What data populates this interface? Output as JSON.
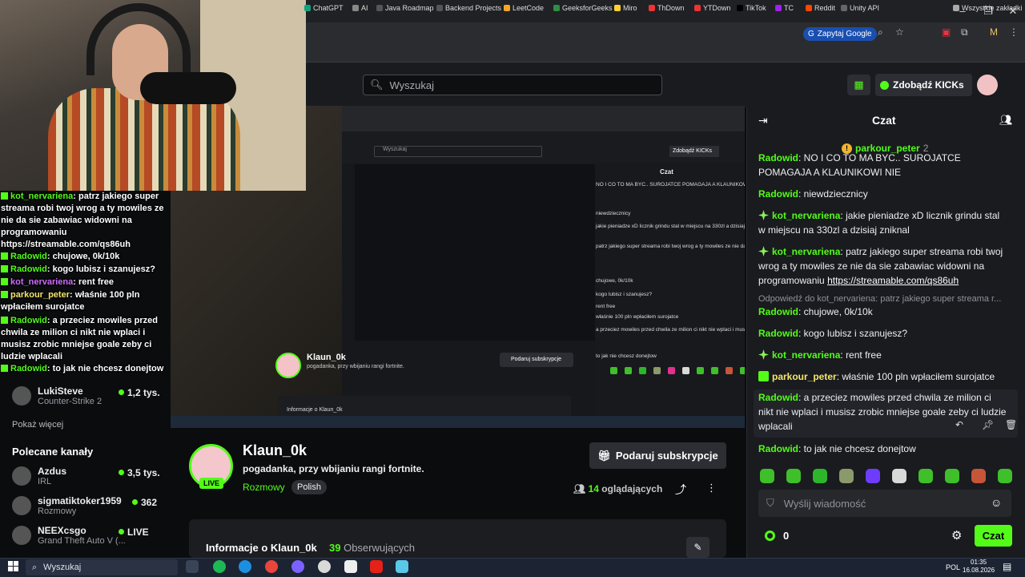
{
  "browser": {
    "google_chip": "Zapytaj Google",
    "bookmarks": [
      "ChatGPT",
      "AI",
      "Java Roadmap",
      "Backend Projects",
      "LeetCode",
      "GeeksforGeeks",
      "Miro",
      "ThDown",
      "YTDown",
      "TikTok",
      "TC",
      "Reddit",
      "Unity API"
    ],
    "all_bookmarks": "Wszystkie zakładki"
  },
  "header": {
    "search_placeholder": "Wyszukaj",
    "kicks_button": "Zdobądź KICKs"
  },
  "overlay_chat": [
    {
      "user": "kot_nervariena",
      "text": "patrz jakiego super streama robi twoj wrog a ty mowiles ze nie da sie zabawiac widowni na programowaniu https://streamable.com/qs86uh"
    },
    {
      "user": "Radowid",
      "text": "chujowe, 0k/10k"
    },
    {
      "user": "Radowid",
      "text": "kogo lubisz i szanujesz?"
    },
    {
      "user": "kot_nervariena",
      "text": "rent free"
    },
    {
      "user": "parkour_peter",
      "text": "właśnie 100 pln wpłaciłem surojatce"
    },
    {
      "user": "Radowid",
      "text": "a przeciez mowiles przed chwila ze milion ci nikt nie wplaci i musisz zrobic mniejse goale zeby ci ludzie wplacali"
    },
    {
      "user": "Radowid",
      "text": "to jak nie chcesz donejtow"
    }
  ],
  "sidebar": {
    "show_more": "Pokaż więcej",
    "recommended_title": "Polecane kanały",
    "followed": [
      {
        "name": "LukiSteve",
        "category": "Counter-Strike 2",
        "viewers": "1,2 tys."
      }
    ],
    "recommended": [
      {
        "name": "Azdus",
        "category": "IRL",
        "viewers": "3,5 tys."
      },
      {
        "name": "sigmatiktoker1959",
        "category": "Rozmowy",
        "viewers": "362"
      },
      {
        "name": "NEEXcsgo",
        "category": "Grand Theft Auto V (...",
        "viewers": "LIVE"
      }
    ]
  },
  "channel": {
    "name": "Klaun_0k",
    "live_badge": "LIVE",
    "description": "pogadanka, przy wbijaniu rangi fortnite.",
    "category": "Rozmowy",
    "tag": "Polish",
    "subscribe": "Podaruj subskrypcje",
    "viewers_count": "14",
    "viewers_label": "oglądających",
    "about_title": "Informacje o Klaun_0k",
    "followers_count": "39",
    "followers_label": "Obserwujących"
  },
  "chat": {
    "title": "Czat",
    "pinned_user": "parkour_peter",
    "pinned_count": "2",
    "messages": [
      {
        "user": "Radowid",
        "text": "NO I CO TO MA BYC.. SUROJATCE POMAGAJA A KLAUNIKOWI NIE"
      },
      {
        "user": "Radowid",
        "text": "niewdziecznicy"
      },
      {
        "user": "kot_nervariena",
        "text": "jakie pieniadze xD licznik grindu stal w miejscu na 330zl a dzisiaj zniknal"
      },
      {
        "user": "kot_nervariena",
        "text": "patrz jakiego super streama robi twoj wrog a ty mowiles ze nie da sie zabawiac widowni na programowaniu",
        "link": "https://streamable.com/qs86uh"
      },
      {
        "user": "Radowid",
        "text": "chujowe, 0k/10k"
      },
      {
        "user": "Radowid",
        "text": "kogo lubisz i szanujesz?"
      },
      {
        "user": "kot_nervariena",
        "text": "rent free"
      },
      {
        "user": "parkour_peter",
        "text": "właśnie 100 pln wpłaciłem surojatce"
      },
      {
        "user": "Radowid",
        "text": "a przeciez mowiles przed chwila ze milion ci nikt nie wplaci i musisz zrobic mniejse goale zeby ci ludzie wplacali"
      },
      {
        "user": "Radowid",
        "text": "to jak nie chcesz donejtow"
      }
    ],
    "reply_note": "Odpowiedź do kot_nervariena: patrz jakiego super streama r...",
    "input_placeholder": "Wyślij wiadomość",
    "points": "0",
    "send": "Czat",
    "colors": {
      "radowid": "#53fc18",
      "kot": "#53fc18",
      "accent": "#53fc18"
    }
  },
  "taskbar": {
    "search": "Wyszukaj",
    "lang": "POL",
    "time": "01:35",
    "date": "16.08.2026"
  }
}
